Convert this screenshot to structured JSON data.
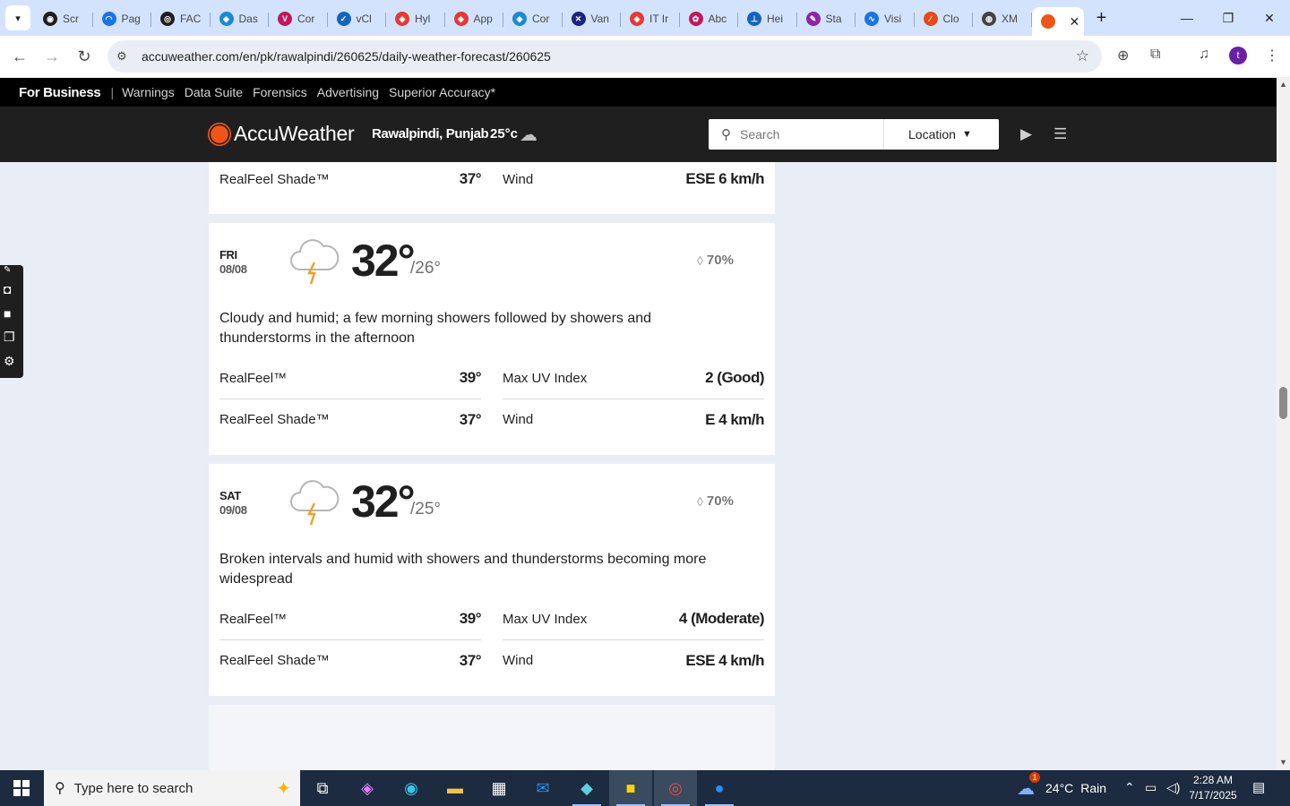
{
  "browser": {
    "tabs": [
      {
        "label": "Scr",
        "fav_color": "#1f1f1f",
        "fav_glyph": "◉"
      },
      {
        "label": "Pag",
        "fav_color": "#1a73e8",
        "fav_glyph": "◠"
      },
      {
        "label": "FAC",
        "fav_color": "#1f1f1f",
        "fav_glyph": "◎"
      },
      {
        "label": "Das",
        "fav_color": "#1a8ad4",
        "fav_glyph": "◆"
      },
      {
        "label": "Cor",
        "fav_color": "#c2185b",
        "fav_glyph": "V"
      },
      {
        "label": "vCl",
        "fav_color": "#1565c0",
        "fav_glyph": "✓"
      },
      {
        "label": "Hyl",
        "fav_color": "#e53935",
        "fav_glyph": "◈"
      },
      {
        "label": "App",
        "fav_color": "#e53935",
        "fav_glyph": "◈"
      },
      {
        "label": "Cor",
        "fav_color": "#1a8ad4",
        "fav_glyph": "◆"
      },
      {
        "label": "Van",
        "fav_color": "#1a237e",
        "fav_glyph": "✕"
      },
      {
        "label": "IT Ir",
        "fav_color": "#e53935",
        "fav_glyph": "◈"
      },
      {
        "label": "Abc",
        "fav_color": "#c2185b",
        "fav_glyph": "✿"
      },
      {
        "label": "Hei",
        "fav_color": "#1565c0",
        "fav_glyph": "⊥"
      },
      {
        "label": "Sta",
        "fav_color": "#8e24aa",
        "fav_glyph": "✎"
      },
      {
        "label": "Visi",
        "fav_color": "#1a73e8",
        "fav_glyph": "∿"
      },
      {
        "label": "Clo",
        "fav_color": "#e64a19",
        "fav_glyph": "∕"
      },
      {
        "label": "XM",
        "fav_color": "#444444",
        "fav_glyph": "◍"
      }
    ],
    "active_tab_close": "✕",
    "new_tab": "+",
    "url": "accuweather.com/en/pk/rawalpindi/260625/daily-weather-forecast/260625",
    "profile_initial": "t"
  },
  "site": {
    "business_bar": {
      "title": "For Business",
      "separator": "|",
      "links": [
        "Warnings",
        "Data Suite",
        "Forensics",
        "Advertising",
        "Superior Accuracy*"
      ]
    },
    "brand": "AccuWeather",
    "location": "Rawalpindi, Punjab",
    "current_temp": "25°c",
    "search_placeholder": "Search",
    "location_button": "Location",
    "accent_color": "#f05514"
  },
  "forecast": {
    "top_partial": {
      "realfeel_shade_label": "RealFeel Shade™",
      "realfeel_shade_value": "37°",
      "wind_label": "Wind",
      "wind_value": "ESE 6 km/h"
    },
    "days": [
      {
        "day": "FRI",
        "date": "08/08",
        "high": "32°",
        "low": "/26°",
        "precip": "70%",
        "icon": "thunderstorm-icon",
        "phrase": "Cloudy and humid; a few morning showers followed by showers and thunderstorms in the afternoon",
        "realfeel_label": "RealFeel™",
        "realfeel_value": "39°",
        "uv_label": "Max UV Index",
        "uv_value": "2 (Good)",
        "realfeel_shade_label": "RealFeel Shade™",
        "realfeel_shade_value": "37°",
        "wind_label": "Wind",
        "wind_value": "E 4 km/h"
      },
      {
        "day": "SAT",
        "date": "09/08",
        "high": "32°",
        "low": "/25°",
        "precip": "70%",
        "icon": "thunderstorm-icon",
        "phrase": "Broken intervals and humid with showers and thunderstorms becoming more widespread",
        "realfeel_label": "RealFeel™",
        "realfeel_value": "39°",
        "uv_label": "Max UV Index",
        "uv_value": "4 (Moderate)",
        "realfeel_shade_label": "RealFeel Shade™",
        "realfeel_shade_value": "37°",
        "wind_label": "Wind",
        "wind_value": "ESE 4 km/h"
      }
    ]
  },
  "taskbar": {
    "search_placeholder": "Type here to search",
    "weather_temp": "24°C",
    "weather_text": "Rain",
    "weather_badge": "1",
    "time": "2:28 AM",
    "date": "7/17/2025",
    "notification_count": "1"
  }
}
